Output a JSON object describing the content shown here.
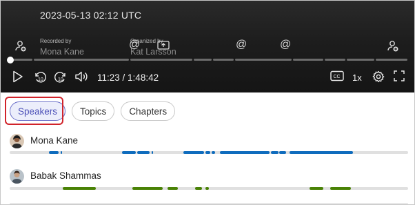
{
  "player": {
    "timestamp": "2023-05-13 02:12 UTC",
    "recorded_by_label": "Recorded by",
    "recorded_by_name": "Mona Kane",
    "organized_by_label": "Organized by",
    "organized_by_name": "Kat Larsson",
    "current_time": "11:23",
    "duration": "1:48:42",
    "time_separator": " / ",
    "speed": "1x",
    "progress_fraction": 0.0
  },
  "tabs": [
    {
      "label": "Speakers",
      "active": true
    },
    {
      "label": "Topics",
      "active": false
    },
    {
      "label": "Chapters",
      "active": false
    }
  ],
  "speakers": [
    {
      "name": "Mona Kane",
      "color": "#0f6cbd",
      "segments_fraction": [
        [
          0.0985,
          0.1235
        ],
        [
          0.1275,
          0.1295
        ],
        [
          0.282,
          0.316
        ],
        [
          0.32,
          0.352
        ],
        [
          0.356,
          0.359
        ],
        [
          0.436,
          0.488
        ],
        [
          0.492,
          0.503
        ],
        [
          0.507,
          0.516
        ],
        [
          0.527,
          0.652
        ],
        [
          0.655,
          0.674
        ],
        [
          0.677,
          0.694
        ],
        [
          0.703,
          0.862
        ]
      ]
    },
    {
      "name": "Babak Shammas",
      "color": "#498205",
      "segments_fraction": [
        [
          0.134,
          0.216
        ],
        [
          0.308,
          0.384
        ],
        [
          0.396,
          0.422
        ],
        [
          0.466,
          0.482
        ],
        [
          0.492,
          0.5
        ],
        [
          0.753,
          0.787
        ],
        [
          0.805,
          0.857
        ]
      ]
    }
  ],
  "icons": {
    "add_person": "person-add-icon",
    "mention": "at-icon",
    "share_screen": "share-screen-icon",
    "play": "play-icon",
    "rewind": "rewind-10-icon",
    "forward": "forward-10-icon",
    "volume": "volume-icon",
    "captions": "captions-icon",
    "settings": "gear-icon",
    "fullscreen": "fullscreen-icon"
  }
}
